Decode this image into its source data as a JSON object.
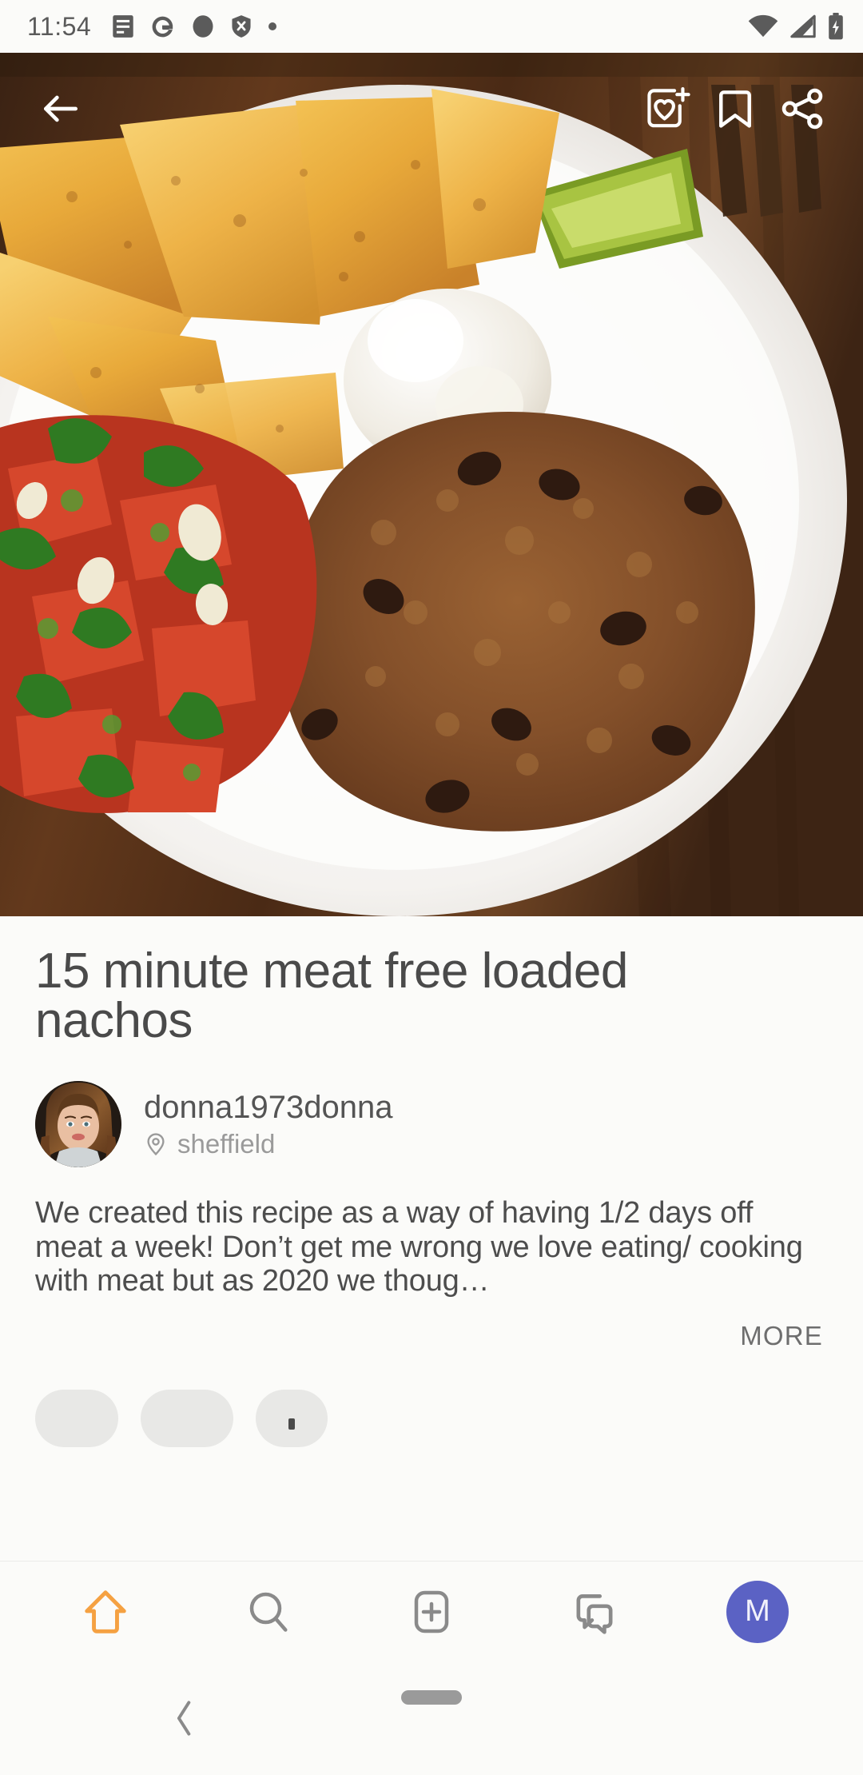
{
  "status_bar": {
    "time": "11:54",
    "left_icons": [
      "notes-icon",
      "google-icon",
      "circle-icon",
      "shield-x-icon",
      "dot-icon"
    ],
    "right_icons": [
      "wifi-icon",
      "cellular-signal-off-icon",
      "battery-charging-icon"
    ]
  },
  "action_bar": {
    "back_icon": "back-arrow-icon",
    "add_to_cookbook_icon": "add-to-cookbook-icon",
    "bookmark_icon": "bookmark-icon",
    "share_icon": "share-icon"
  },
  "recipe": {
    "title": "15 minute meat free loaded nachos",
    "author": "donna1973donna",
    "location": "sheffield",
    "location_icon": "location-pin-icon",
    "description": "We created this recipe as a way of having 1/2 days off meat a week! Don’t get me wrong we love eating/ cooking with meat but as 2020 we thoug…",
    "more_label": "MORE"
  },
  "bottom_nav": {
    "items": [
      {
        "name": "home",
        "icon": "home-icon",
        "active": true
      },
      {
        "name": "search",
        "icon": "search-icon",
        "active": false
      },
      {
        "name": "create",
        "icon": "add-recipe-icon",
        "active": false
      },
      {
        "name": "chat",
        "icon": "chat-bubbles-icon",
        "active": false
      },
      {
        "name": "profile",
        "icon": "profile-avatar",
        "label": "M",
        "active": false
      }
    ]
  },
  "system_nav": {
    "back_icon": "system-back-icon",
    "home_pill": "gesture-pill"
  },
  "colors": {
    "accent_orange": "#F5A142",
    "avatar_indigo": "#5B62C4",
    "background": "#FBFBF9",
    "text_primary": "#4A4A4A",
    "text_muted": "#9A9A9A"
  }
}
